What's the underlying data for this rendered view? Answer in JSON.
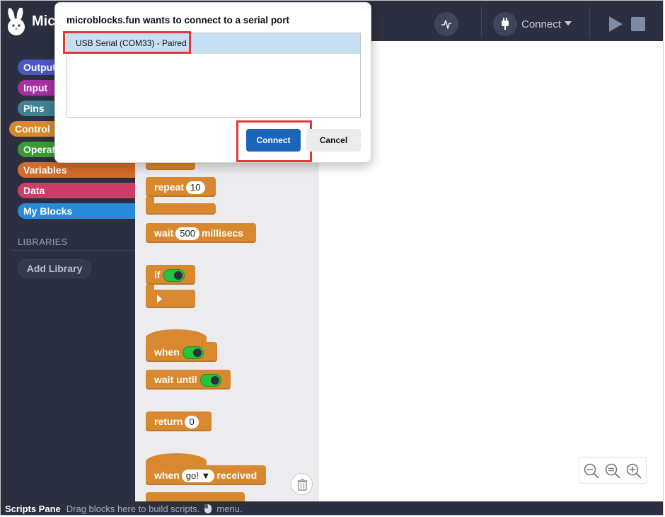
{
  "app": {
    "title": "Mic"
  },
  "toolbar": {
    "connect_label": "Connect"
  },
  "sidebar": {
    "categories": [
      {
        "label": "Output",
        "color": "#4a56c2"
      },
      {
        "label": "Input",
        "color": "#a530a5"
      },
      {
        "label": "Pins",
        "color": "#3f8191"
      },
      {
        "label": "Control",
        "color": "#d8882f"
      },
      {
        "label": "Operators",
        "color": "#3a9a34"
      },
      {
        "label": "Variables",
        "color": "#d36c2a"
      },
      {
        "label": "Data",
        "color": "#cc3d6a"
      },
      {
        "label": "My Blocks",
        "color": "#2a8bd9"
      }
    ],
    "libraries_label": "LIBRARIES",
    "add_library_label": "Add Library"
  },
  "palette": {
    "repeat_label": "repeat",
    "repeat_count": "10",
    "wait_label": "wait",
    "wait_value": "500",
    "wait_unit": "millisecs",
    "if_label": "if",
    "when_label": "when",
    "wait_until_label": "wait until",
    "return_label": "return",
    "return_value": "0",
    "when_received_prefix": "when",
    "when_received_msg": "go! ▼",
    "when_received_suffix": "received"
  },
  "statusbar": {
    "title": "Scripts Pane",
    "hint": "Drag blocks here to build scripts.",
    "menu_text": "menu."
  },
  "dialog": {
    "title": "microblocks.fun wants to connect to a serial port",
    "port": "USB Serial (COM33) - Paired",
    "connect_label": "Connect",
    "cancel_label": "Cancel"
  }
}
